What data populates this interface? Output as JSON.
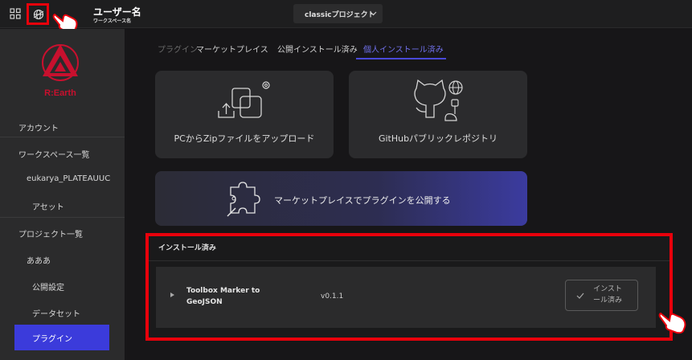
{
  "header": {
    "user_name": "ユーザー名",
    "workspace_name": "ワークスペース名",
    "project_name": "classicプロジェクト"
  },
  "sidebar": {
    "brand": "R:Earth",
    "items": [
      {
        "label": "アカウント"
      },
      {
        "label": "ワークスペース一覧"
      },
      {
        "label": "eukarya_PLATEAUUC"
      },
      {
        "label": "アセット"
      },
      {
        "label": "プロジェクト一覧"
      },
      {
        "label": "あああ"
      },
      {
        "label": "公開設定"
      },
      {
        "label": "データセット"
      },
      {
        "label": "プラグイン"
      }
    ]
  },
  "tabs": [
    {
      "label": "プラグイン"
    },
    {
      "label": "マーケットプレイス"
    },
    {
      "label": "公開インストール済み"
    },
    {
      "label": "個人インストール済み"
    }
  ],
  "cards": {
    "upload": "PCからZipファイルをアップロード",
    "github": "GitHubパブリックレポジトリ",
    "publish": "マーケットプレイスでプラグインを公開する"
  },
  "installed": {
    "title": "インストール済み",
    "plugins": [
      {
        "name": "Toolbox Marker to GeoJSON",
        "version": "v0.1.1",
        "status": "インストール済み"
      }
    ]
  },
  "colors": {
    "accent": "#3b3bdb",
    "highlight": "#e8000b",
    "logo": "#c8102e"
  }
}
